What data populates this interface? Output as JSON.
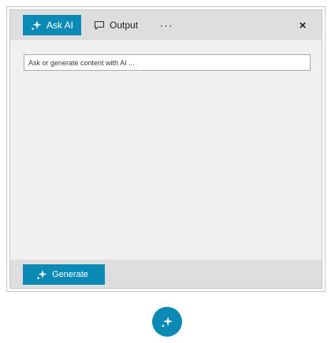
{
  "panel": {
    "tabs": [
      {
        "label": "Ask AI",
        "icon": "sparkle-icon",
        "active": true
      },
      {
        "label": "Output",
        "icon": "speech-bubble-icon",
        "active": false
      }
    ],
    "more_label": "···",
    "close_label": "×"
  },
  "prompt": {
    "placeholder": "Ask or generate content with AI ...",
    "value": ""
  },
  "footer": {
    "generate_label": "Generate",
    "generate_icon": "sparkle-icon"
  },
  "fab": {
    "icon": "sparkle-icon"
  },
  "colors": {
    "accent": "#0a8ab5",
    "toolbar_bg": "#dedede",
    "panel_bg": "#f0f0f0"
  }
}
